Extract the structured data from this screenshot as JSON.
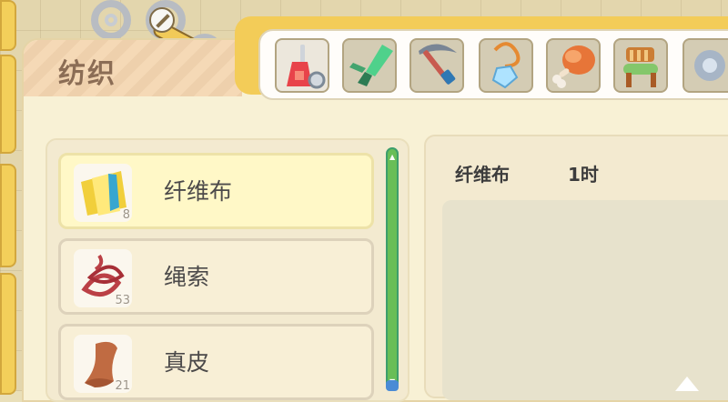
{
  "panel": {
    "title": "纺织"
  },
  "toolbar": {
    "slots": [
      {
        "icon": "screwdriver-icon"
      },
      {
        "icon": "green-blade-icon"
      },
      {
        "icon": "pickaxe-icon"
      },
      {
        "icon": "pendant-icon"
      },
      {
        "icon": "meat-icon"
      },
      {
        "icon": "chair-icon"
      },
      {
        "icon": "gear-icon"
      }
    ]
  },
  "list": {
    "items": [
      {
        "name": "纤维布",
        "count": "8",
        "icon": "fiber-cloth-icon"
      },
      {
        "name": "绳索",
        "count": "53",
        "icon": "rope-icon"
      },
      {
        "name": "真皮",
        "count": "21",
        "icon": "leather-icon"
      }
    ]
  },
  "detail": {
    "name": "纤维布",
    "time": "1时"
  }
}
